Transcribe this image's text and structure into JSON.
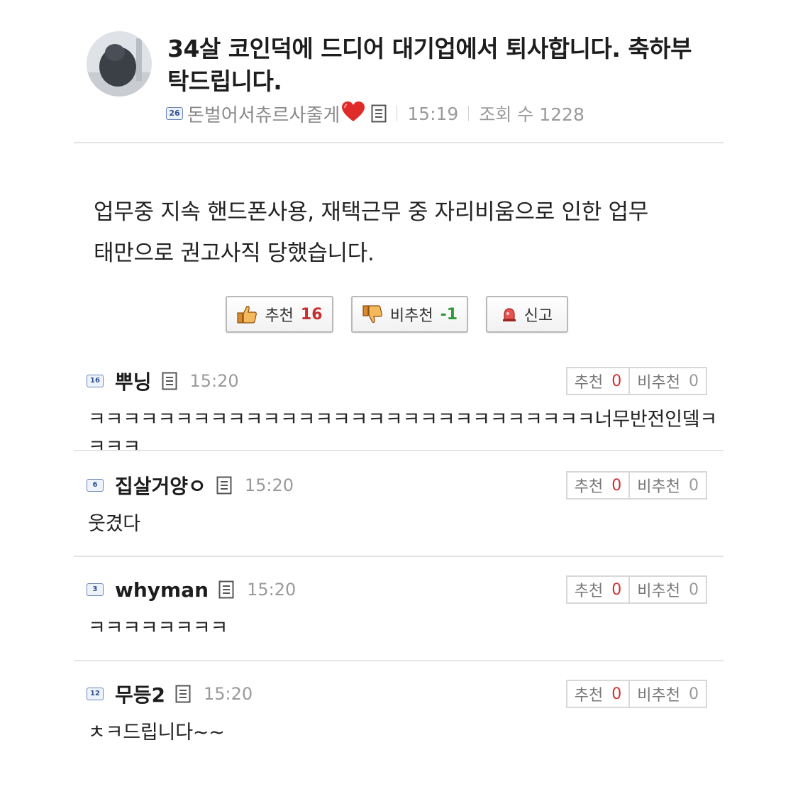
{
  "post": {
    "title": "34살 코인덕에 드디어 대기업에서 퇴사합니다. 축하부탁드립니다.",
    "author": {
      "level": "26",
      "nickname": "돈벌어서츄르사줄게"
    },
    "time": "15:19",
    "views_label": "조회 수 1228",
    "body_line1": "업무중 지속 핸드폰사용, 재택근무 중 자리비움으로 인한 업무",
    "body_line2": "태만으로 권고사직 당했습니다."
  },
  "votes": {
    "up_label": "추천",
    "up_count": "16",
    "down_label": "비추천",
    "down_count": "-1",
    "report_label": "신고"
  },
  "comments": [
    {
      "level": "16",
      "author": "뿌닝",
      "time": "15:20",
      "up_label": "추천",
      "up": "0",
      "down_label": "비추천",
      "down": "0",
      "text": "ㅋㅋㅋㅋㅋㅋㅋㅋㅋㅋㅋㅋㅋㅋㅋㅋㅋㅋㅋㅋㅋㅋㅋㅋㅋㅋㅋㅋㅋ너무반전인뎈ㅋㅋㅋㅋ"
    },
    {
      "level": "6",
      "author": "집살거양ㅇ",
      "time": "15:20",
      "up_label": "추천",
      "up": "0",
      "down_label": "비추천",
      "down": "0",
      "text": "웃겼다"
    },
    {
      "level": "3",
      "author": "whyman",
      "time": "15:20",
      "up_label": "추천",
      "up": "0",
      "down_label": "비추천",
      "down": "0",
      "text": "ㅋㅋㅋㅋㅋㅋㅋㅋ"
    },
    {
      "level": "12",
      "author": "무등2",
      "time": "15:20",
      "up_label": "추천",
      "up": "0",
      "down_label": "비추천",
      "down": "0",
      "text": "ㅊㅋ드립니다~~"
    }
  ],
  "icons": {
    "heart": "heart-icon",
    "doc": "document-icon",
    "thumbs_up": "thumbs-up-icon",
    "thumbs_down": "thumbs-down-icon",
    "siren": "siren-icon"
  },
  "colors": {
    "up_count": "#c62f2f",
    "down_count": "#2f9a3a",
    "heart": "#e02b2b"
  }
}
